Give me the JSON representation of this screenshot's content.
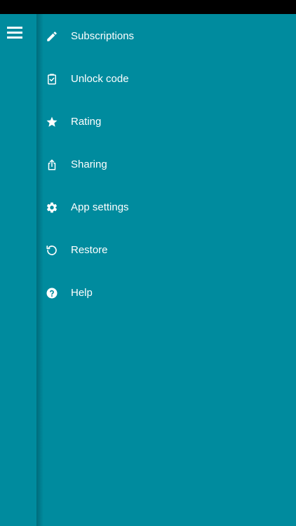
{
  "theme": {
    "background": "#008B9E",
    "status_bar": "#000000",
    "text": "#FFFFFF"
  },
  "toolbar": {
    "menu_icon": "hamburger-menu-icon"
  },
  "menu": {
    "items": [
      {
        "label": "Subscriptions",
        "icon": "pencil-icon"
      },
      {
        "label": "Unlock code",
        "icon": "clipboard-check-icon"
      },
      {
        "label": "Rating",
        "icon": "star-icon"
      },
      {
        "label": "Sharing",
        "icon": "share-icon"
      },
      {
        "label": "App settings",
        "icon": "gear-icon"
      },
      {
        "label": "Restore",
        "icon": "restore-icon"
      },
      {
        "label": "Help",
        "icon": "help-icon"
      }
    ]
  }
}
